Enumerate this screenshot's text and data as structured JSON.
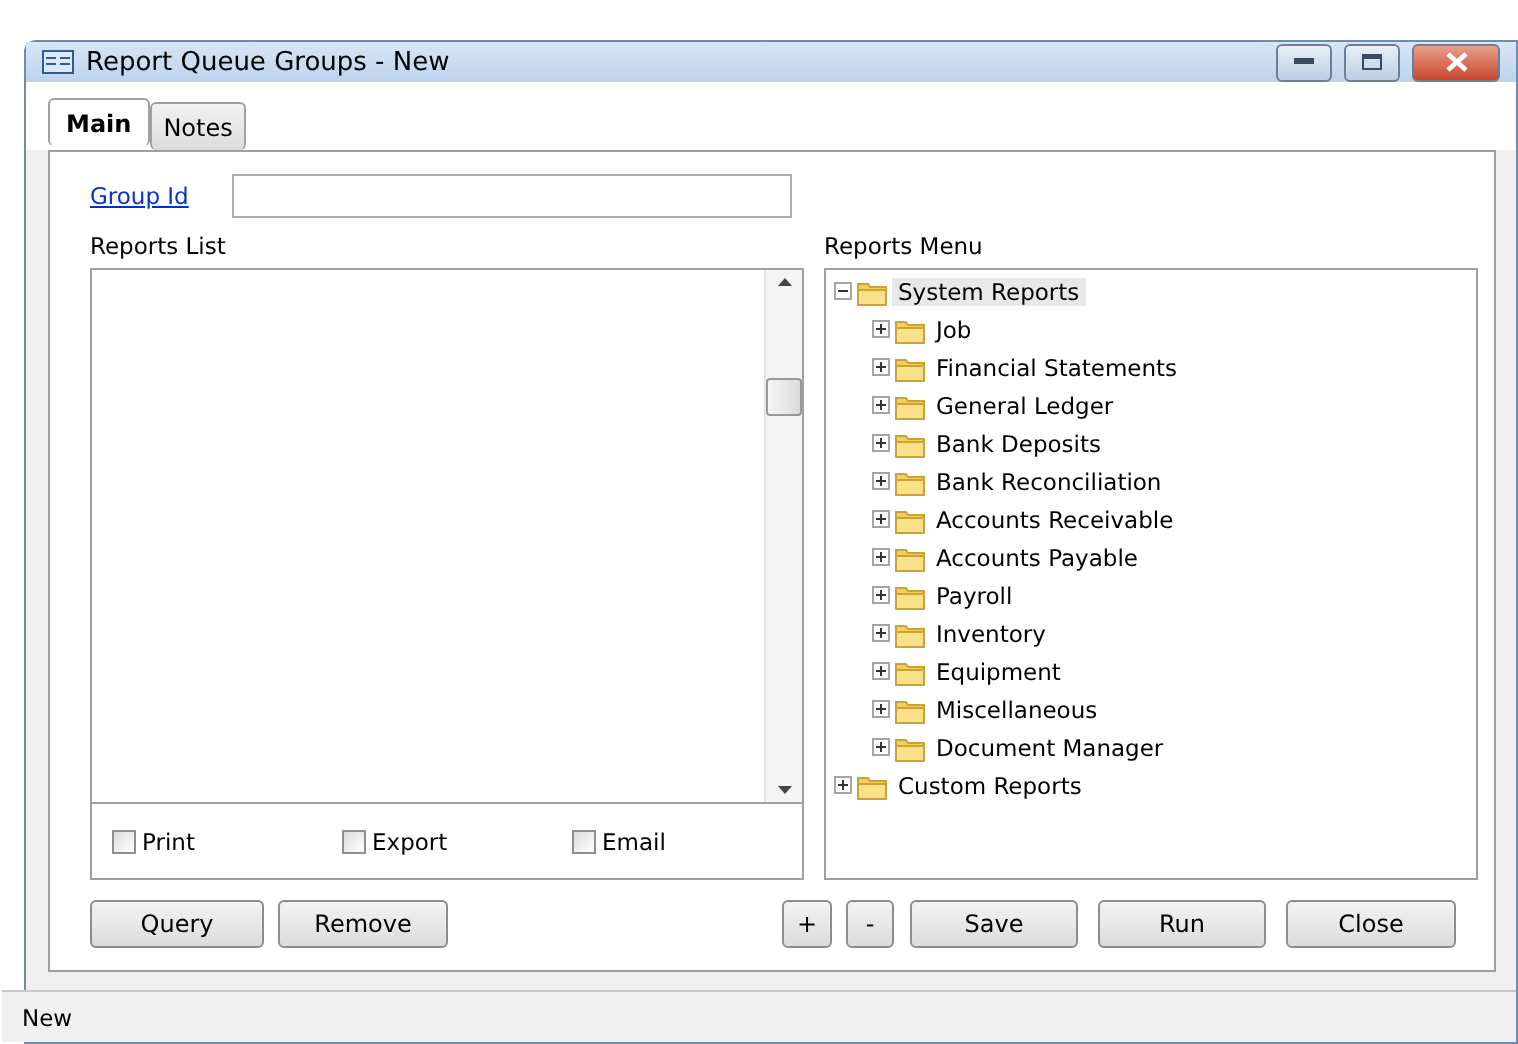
{
  "window": {
    "title": "Report Queue Groups - New"
  },
  "tabs": [
    {
      "label": "Main",
      "selected": true
    },
    {
      "label": "Notes",
      "selected": false
    }
  ],
  "group_id": {
    "label": "Group Id"
  },
  "reports_list": {
    "label": "Reports List",
    "options": [
      {
        "label": "Print",
        "checked": false
      },
      {
        "label": "Export",
        "checked": false
      },
      {
        "label": "Email",
        "checked": false
      }
    ]
  },
  "reports_menu": {
    "label": "Reports Menu",
    "tree": [
      {
        "label": "System Reports",
        "expanded": true,
        "selected": true,
        "children": [
          {
            "label": "Job",
            "expanded": false,
            "selected": false
          },
          {
            "label": "Financial Statements",
            "expanded": false,
            "selected": false
          },
          {
            "label": "General Ledger",
            "expanded": false,
            "selected": false
          },
          {
            "label": "Bank Deposits",
            "expanded": false,
            "selected": false
          },
          {
            "label": "Bank Reconciliation",
            "expanded": false,
            "selected": false
          },
          {
            "label": "Accounts Receivable",
            "expanded": false,
            "selected": false
          },
          {
            "label": "Accounts Payable",
            "expanded": false,
            "selected": false
          },
          {
            "label": "Payroll",
            "expanded": false,
            "selected": false
          },
          {
            "label": "Inventory",
            "expanded": false,
            "selected": false
          },
          {
            "label": "Equipment",
            "expanded": false,
            "selected": false
          },
          {
            "label": "Miscellaneous",
            "expanded": false,
            "selected": false
          },
          {
            "label": "Document Manager",
            "expanded": false,
            "selected": false
          }
        ]
      },
      {
        "label": "Custom Reports",
        "expanded": false,
        "selected": false
      }
    ]
  },
  "left_buttons": [
    "Query",
    "Remove"
  ],
  "right_buttons": [
    "+",
    "-",
    "Save",
    "Run",
    "Close"
  ],
  "status_bar": "New"
}
